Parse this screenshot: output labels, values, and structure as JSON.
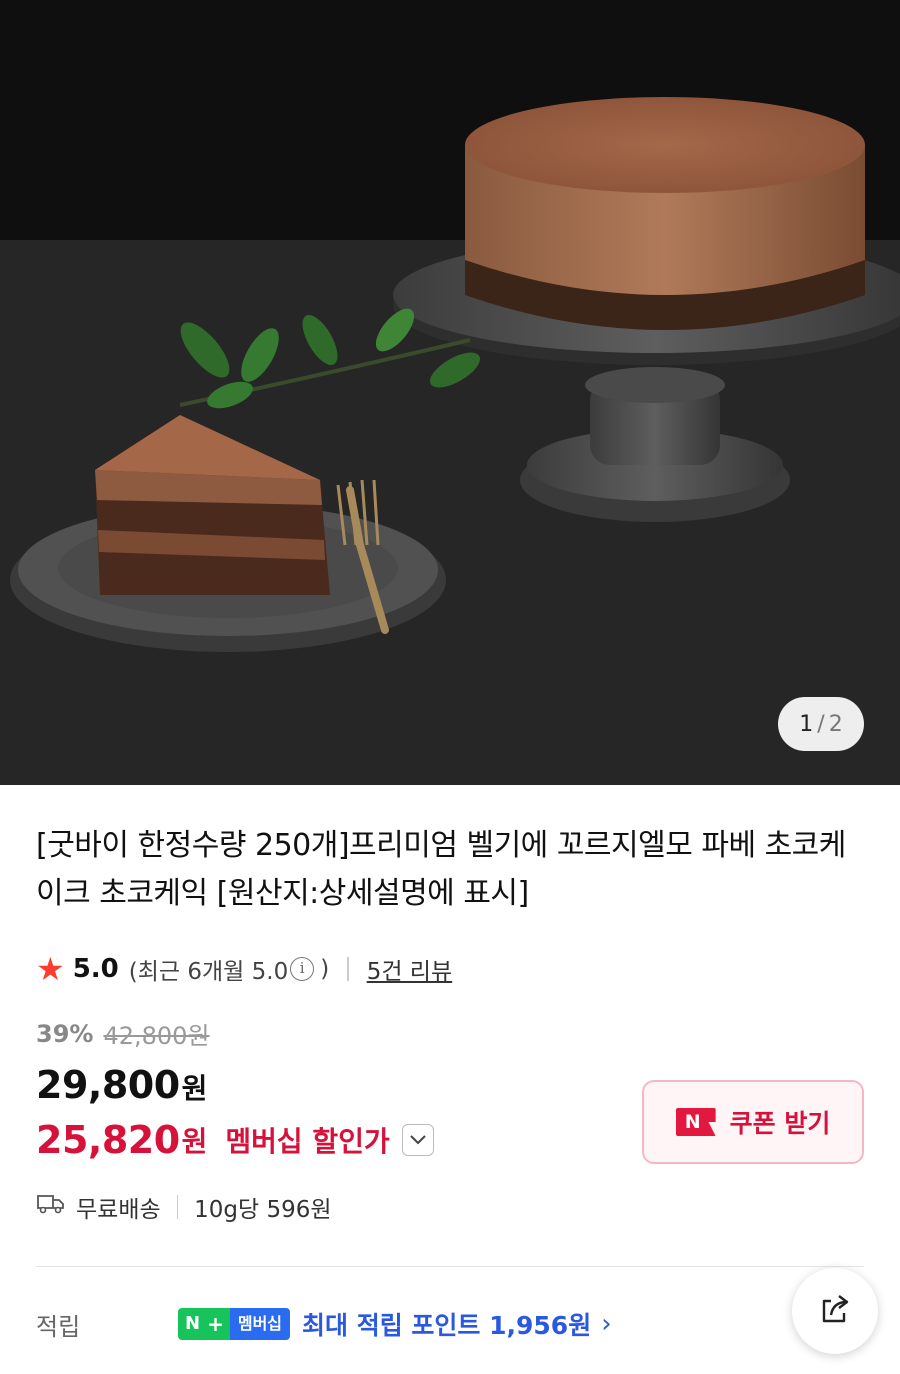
{
  "gallery": {
    "current": "1",
    "separator": "/",
    "total": "2",
    "image_alt": "chocolate cake on stand with slice"
  },
  "product": {
    "title": "[굿바이 한정수량 250개]프리미엄 벨기에 꼬르지엘모 파베 초코케이크 초코케익 [원산지:상세설명에 표시]"
  },
  "rating": {
    "star_icon": "star-icon",
    "score": "5.0",
    "recent": "(최근 6개월 5.0",
    "recent_close": ")",
    "info_icon": "i",
    "reviews": "5건 리뷰"
  },
  "pricing": {
    "discount_pct": "39%",
    "original_price": "42,800원",
    "price": "29,800",
    "price_unit": "원",
    "member_price": "25,820",
    "member_unit": "원",
    "member_label": "멤버십 할인가",
    "member_chevron": "⌄",
    "colors": {
      "member": "#d6113a",
      "points": "#2a59e0"
    }
  },
  "coupon": {
    "badge": "N",
    "label": "쿠폰 받기"
  },
  "shipping": {
    "free": "무료배송",
    "unit_price": "10g당 596원"
  },
  "points": {
    "label": "적립",
    "badge_n": "N",
    "badge_plus": "+",
    "badge_membership": "멤버십",
    "text": "최대 적립 포인트 1,956원",
    "chevron": "›"
  },
  "share": {
    "icon": "share-icon"
  }
}
